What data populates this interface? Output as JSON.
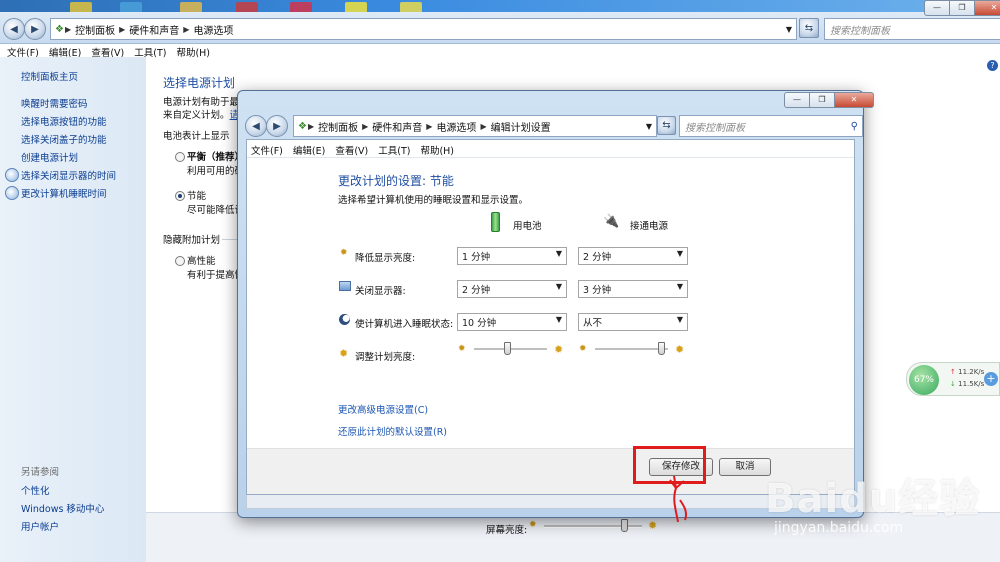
{
  "outer": {
    "breadcrumb": [
      "控制面板",
      "硬件和声音",
      "电源选项"
    ],
    "search_placeholder": "搜索控制面板",
    "menu": [
      "文件(F)",
      "编辑(E)",
      "查看(V)",
      "工具(T)",
      "帮助(H)"
    ],
    "sidebar": {
      "home": "控制面板主页",
      "links": [
        "唤醒时需要密码",
        "选择电源按钮的功能",
        "选择关闭盖子的功能",
        "创建电源计划",
        "选择关闭显示器的时间",
        "更改计算机睡眠时间"
      ],
      "see_also_title": "另请参阅",
      "see_also": [
        "个性化",
        "Windows 移动中心",
        "用户帐户"
      ]
    },
    "main": {
      "title": "选择电源计划",
      "desc1": "电源计划有助于最大",
      "desc2": "来自定义计划。",
      "desc2_link": "请",
      "battery_section": "电池表计上显示",
      "plan1_name": "平衡（推荐）",
      "plan1_desc": "利用可用的硬",
      "plan2_name": "节能",
      "plan2_desc": "尽可能降低计",
      "hidden_section": "隐藏附加计划",
      "plan3_name": "高性能",
      "plan3_desc": "有利于提高性"
    },
    "bottom": {
      "brightness_label": "屏幕亮度:",
      "brightness_level": 0.85
    }
  },
  "dialog": {
    "breadcrumb": [
      "控制面板",
      "硬件和声音",
      "电源选项",
      "编辑计划设置"
    ],
    "search_placeholder": "搜索控制面板",
    "menu": [
      "文件(F)",
      "编辑(E)",
      "查看(V)",
      "工具(T)",
      "帮助(H)"
    ],
    "title": "更改计划的设置: 节能",
    "subtitle": "选择希望计算机使用的睡眠设置和显示设置。",
    "col_battery": "用电池",
    "col_plugged": "接通电源",
    "rows": [
      {
        "label": "降低显示亮度:",
        "battery": "1 分钟",
        "plugged": "2 分钟"
      },
      {
        "label": "关闭显示器:",
        "battery": "2 分钟",
        "plugged": "3 分钟"
      },
      {
        "label": "使计算机进入睡眠状态:",
        "battery": "10 分钟",
        "plugged": "从不"
      }
    ],
    "brightness_label": "调整计划亮度:",
    "brightness_battery_level": 0.45,
    "brightness_plugged_level": 0.95,
    "link_advanced": "更改高级电源设置(C)",
    "link_restore": "还原此计划的默认设置(R)",
    "save_label": "保存修改",
    "cancel_label": "取消"
  },
  "netwidget": {
    "percent": "67%",
    "up": "11.2K/s",
    "down": "11.5K/s"
  },
  "watermark": {
    "brand": "Baidu经验",
    "url": "jingyan.baidu.com"
  },
  "colors": {
    "highlight": "#e01b1b",
    "link": "#1a55b3",
    "title": "#1f4fa3"
  }
}
